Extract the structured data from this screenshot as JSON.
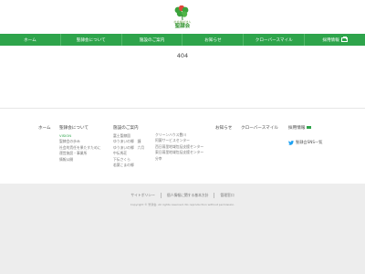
{
  "logo": {
    "subtitle": "社会福祉法人",
    "name": "聖隷会"
  },
  "nav": {
    "items": [
      {
        "label": "ホーム"
      },
      {
        "label": "聖隷会について"
      },
      {
        "label": "施設のご案内"
      },
      {
        "label": "お知らせ"
      },
      {
        "label": "クローバースマイル"
      },
      {
        "label": "採用情報"
      }
    ]
  },
  "main": {
    "message": "404"
  },
  "footer": {
    "home": "ホーム",
    "about": {
      "title": "聖隷会について",
      "links": [
        "VISION",
        "聖隷会の歩み",
        "社会的責任を果たすために",
        "運営施設・事業所",
        "情報公開"
      ]
    },
    "facilities": {
      "title": "施設のご案内",
      "links": [
        "富士聖隷園",
        "ゆうあいの郷　鐘",
        "ゆうあいの郷　六月",
        "中伝馬荘",
        "下伝さくら",
        "若葉こまの郷"
      ]
    },
    "facilities2": {
      "links": [
        "クリーンハウス豊川",
        "阿蘭サービスセンター",
        "西日暮里地域包括支援センター",
        "東日暮里地域包括支援センター",
        "分幸"
      ]
    },
    "news": "お知らせ",
    "clover": "クローバースマイル",
    "recruit": "採用情報",
    "sns": "聖隷会SNS一覧"
  },
  "footer_bottom": {
    "links": [
      "サイトポリシー",
      "個人情報に関する基本方針",
      "管理窓口"
    ],
    "copyright": "Copyright © 聖隷会. All rights reserved. No reproduction without permission."
  },
  "colors": {
    "brand_green": "#2ea44b",
    "footer_bg": "#ededed",
    "twitter_blue": "#1da1f2"
  }
}
